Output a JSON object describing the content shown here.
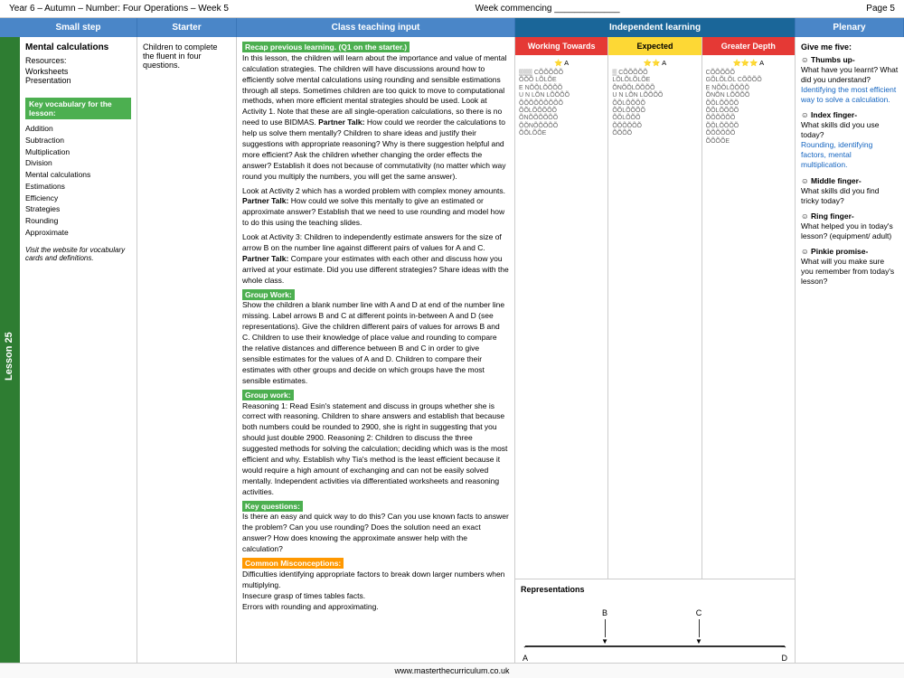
{
  "header": {
    "title": "Year 6 – Autumn – Number: Four Operations – Week 5",
    "week": "Week commencing _____________",
    "page": "Page 5"
  },
  "columns": {
    "small_step": "Small step",
    "starter": "Starter",
    "teaching": "Class teaching input",
    "independent": "Independent learning",
    "plenary": "Plenary"
  },
  "lesson": {
    "number": "Lesson 25"
  },
  "small_step": {
    "title": "Mental calculations",
    "resources_label": "Resources:",
    "resources": "Worksheets\nPresentation",
    "vocab_label": "Key vocabulary for the lesson:",
    "vocab_items": [
      "Addition",
      "Subtraction",
      "Multiplication",
      "Division",
      "Mental calculations",
      "Estimations",
      "Efficiency",
      "Strategies",
      "Rounding",
      "Approximate"
    ],
    "website": "Visit the website for vocabulary cards and definitions."
  },
  "starter": {
    "text": "Children to complete the fluent in four questions."
  },
  "teaching": {
    "recap_label": "Recap previous learning. (Q1 on the starter.)",
    "intro": "In this lesson, the children will learn about the importance and value of mental calculation strategies. The children will have discussions around how to efficiently solve mental calculations using rounding and sensible estimations through all steps. Sometimes children are too quick to move to computational methods, when more efficient mental strategies should be used. Look at Activity 1. Note that these are all single-operation calculations, so there is no need to use BIDMAS.",
    "partner_talk_1": "Partner Talk:",
    "partner_talk_1_text": "How could we reorder the calculations to help us solve them mentally? Children to share ideas and justify their suggestions with appropriate reasoning? Why is there suggestion helpful and more efficient? Ask the children whether changing the order effects the answer? Establish it does not because of commutativity (no matter which way round you multiply the numbers, you will get the same answer).",
    "activity2_text": "Look at Activity 2 which has a worded problem with complex money amounts.",
    "partner_talk_2": "Partner Talk:",
    "partner_talk_2_text": "How could we solve this mentally to give an estimated or approximate answer? Establish that we need to use rounding and model how to do this using the teaching slides.",
    "activity3_text": "Look at Activity 3: Children to independently estimate answers for the size of arrow B on the number line against different pairs of values for A and C.",
    "partner_talk_3": "Partner Talk:",
    "partner_talk_3_text": "Compare your estimates with each other and discuss how you arrived at your estimate. Did you use different strategies? Share ideas with the whole class.",
    "group_work_label": "Group Work:",
    "group_work_1": "Show the children a blank number line with A and D at end of the number line missing. Label arrows B and C at different points in-between A and D (see representations). Give the children different pairs of values for arrows B and C. Children to use their knowledge of place value and rounding to compare the relative distances and difference between B and C in order to give sensible estimates for the values of A and D. Children to compare their estimates with other groups and decide on which groups have the most sensible estimates.",
    "group_work_label_2": "Group work:",
    "group_work_2": "Reasoning 1: Read Esin's statement and discuss in groups whether she is correct with reasoning. Children to share answers and establish that because both numbers could be rounded to 2900, she is right in suggesting that you should just double 2900. Reasoning 2: Children to discuss the three suggested methods for solving the calculation; deciding which was is the most efficient and why. Establish why Tia's method is the least efficient because it would require a high amount of exchanging and can not be easily solved mentally. Independent activities via differentiated worksheets and reasoning activities.",
    "key_questions_label": "Key questions:",
    "key_questions_text": "Is there an easy and quick way to do this? Can you use known facts to answer the problem? Can you use rounding? Does the solution need an exact answer? How does knowing the approximate answer help with the calculation?",
    "misconceptions_label": "Common Misconceptions:",
    "misconceptions_text": "Difficulties identifying appropriate factors to break down larger numbers when multiplying.\nInsecure grasp of times tables facts.\nErrors with rounding and approximating."
  },
  "independent": {
    "working_towards": "Working Towards",
    "expected": "Expected",
    "greater_depth": "Greater Depth",
    "representations": "Representations",
    "number_line_labels": [
      "A",
      "B",
      "C",
      "D"
    ]
  },
  "plenary": {
    "intro": "Give me five:",
    "thumb_label": "Thumbs up-",
    "thumb_text": "What have you learnt? What did you understand?",
    "thumb_blue": "Identifying the most efficient way to solve a calculation.",
    "index_label": "Index finger-",
    "index_text": "What skills did you use today?",
    "index_blue": "Rounding, identifying factors, mental multiplication.",
    "middle_label": "Middle finger-",
    "middle_text": "What skills did you find tricky today?",
    "ring_label": "Ring finger-",
    "ring_text": "What helped you in today's lesson? (equipment/ adult)",
    "pinkie_label": "Pinkie promise-",
    "pinkie_text": "What will you make sure you remember from today's lesson?"
  },
  "footer": {
    "website": "www.masterthecurriculum.co.uk"
  }
}
